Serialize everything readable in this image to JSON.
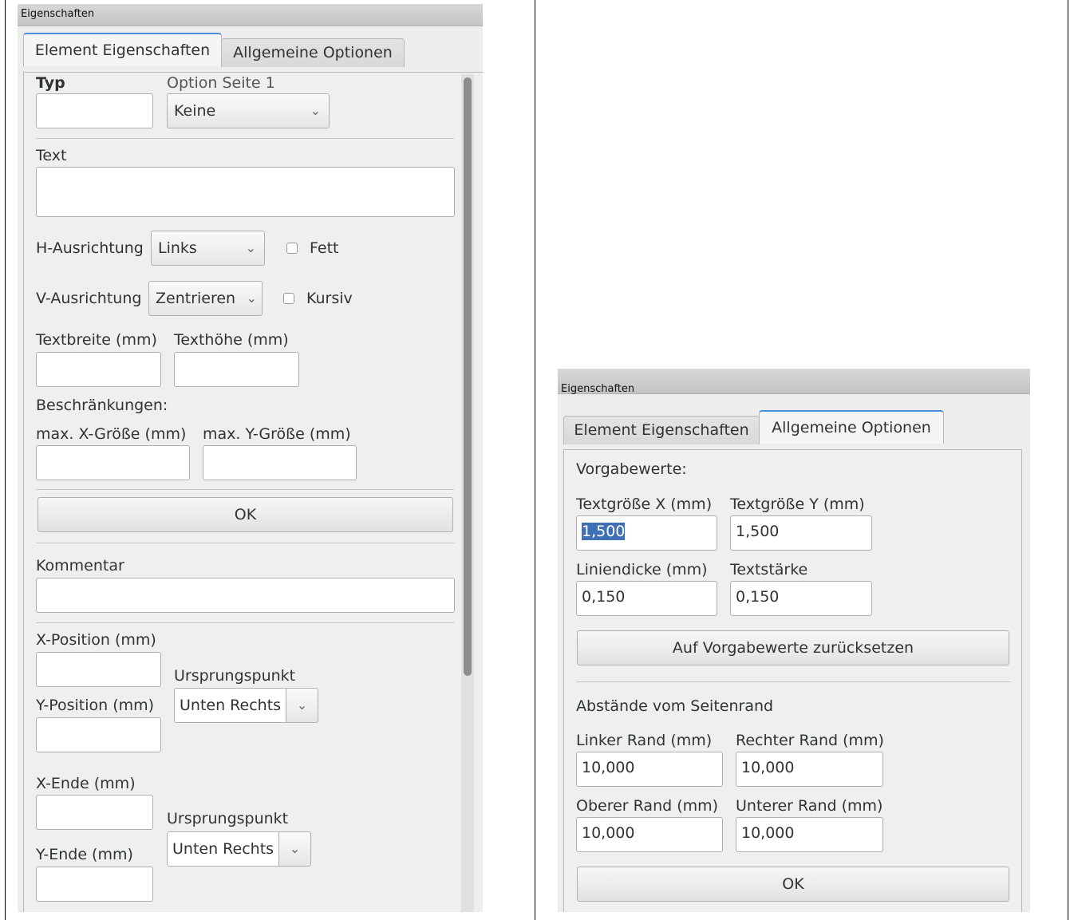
{
  "left_panel": {
    "title": "Eigenschaften",
    "tabs": [
      {
        "label": "Element Eigenschaften",
        "active": true
      },
      {
        "label": "Allgemeine Optionen",
        "active": false
      }
    ],
    "typ": {
      "label": "Typ",
      "value": ""
    },
    "option_page": {
      "label": "Option Seite 1",
      "value": "Keine"
    },
    "text": {
      "label": "Text",
      "value": ""
    },
    "h_align": {
      "label": "H-Ausrichtung",
      "value": "Links"
    },
    "bold": {
      "label": "Fett",
      "checked": false
    },
    "v_align": {
      "label": "V-Ausrichtung",
      "value": "Zentrieren"
    },
    "italic": {
      "label": "Kursiv",
      "checked": false
    },
    "text_width": {
      "label": "Textbreite (mm)",
      "value": ""
    },
    "text_height": {
      "label": "Texthöhe (mm)",
      "value": ""
    },
    "constraints_label": "Beschränkungen:",
    "max_x": {
      "label": "max. X-Größe (mm)",
      "value": ""
    },
    "max_y": {
      "label": "max. Y-Größe (mm)",
      "value": ""
    },
    "ok_label": "OK",
    "comment": {
      "label": "Kommentar",
      "value": ""
    },
    "x_pos": {
      "label": "X-Position (mm)",
      "value": ""
    },
    "origin1": {
      "label": "Ursprungspunkt",
      "value": "Unten Rechts"
    },
    "y_pos": {
      "label": "Y-Position (mm)",
      "value": ""
    },
    "x_end": {
      "label": "X-Ende (mm)",
      "value": ""
    },
    "origin2": {
      "label": "Ursprungspunkt",
      "value": "Unten Rechts"
    },
    "y_end": {
      "label": "Y-Ende (mm)",
      "value": ""
    }
  },
  "right_panel": {
    "title": "Eigenschaften",
    "tabs": [
      {
        "label": "Element Eigenschaften",
        "active": false
      },
      {
        "label": "Allgemeine Optionen",
        "active": true
      }
    ],
    "defaults_label": "Vorgabewerte:",
    "text_size_x": {
      "label": "Textgröße X (mm)",
      "value": "1,500"
    },
    "text_size_y": {
      "label": "Textgröße Y (mm)",
      "value": "1,500"
    },
    "line_width": {
      "label": "Liniendicke (mm)",
      "value": "0,150"
    },
    "text_thickness": {
      "label": "Textstärke",
      "value": "0,150"
    },
    "reset_label": "Auf Vorgabewerte zurücksetzen",
    "margins_label": "Abstände vom Seitenrand",
    "left_margin": {
      "label": "Linker Rand (mm)",
      "value": "10,000"
    },
    "right_margin": {
      "label": "Rechter Rand (mm)",
      "value": "10,000"
    },
    "top_margin": {
      "label": "Oberer Rand (mm)",
      "value": "10,000"
    },
    "bottom_margin": {
      "label": "Unterer Rand (mm)",
      "value": "10,000"
    },
    "ok_label": "OK"
  },
  "colors": {
    "accent": "#4a90d9",
    "selection": "#3f6fb5",
    "panel_bg": "#ededed"
  }
}
